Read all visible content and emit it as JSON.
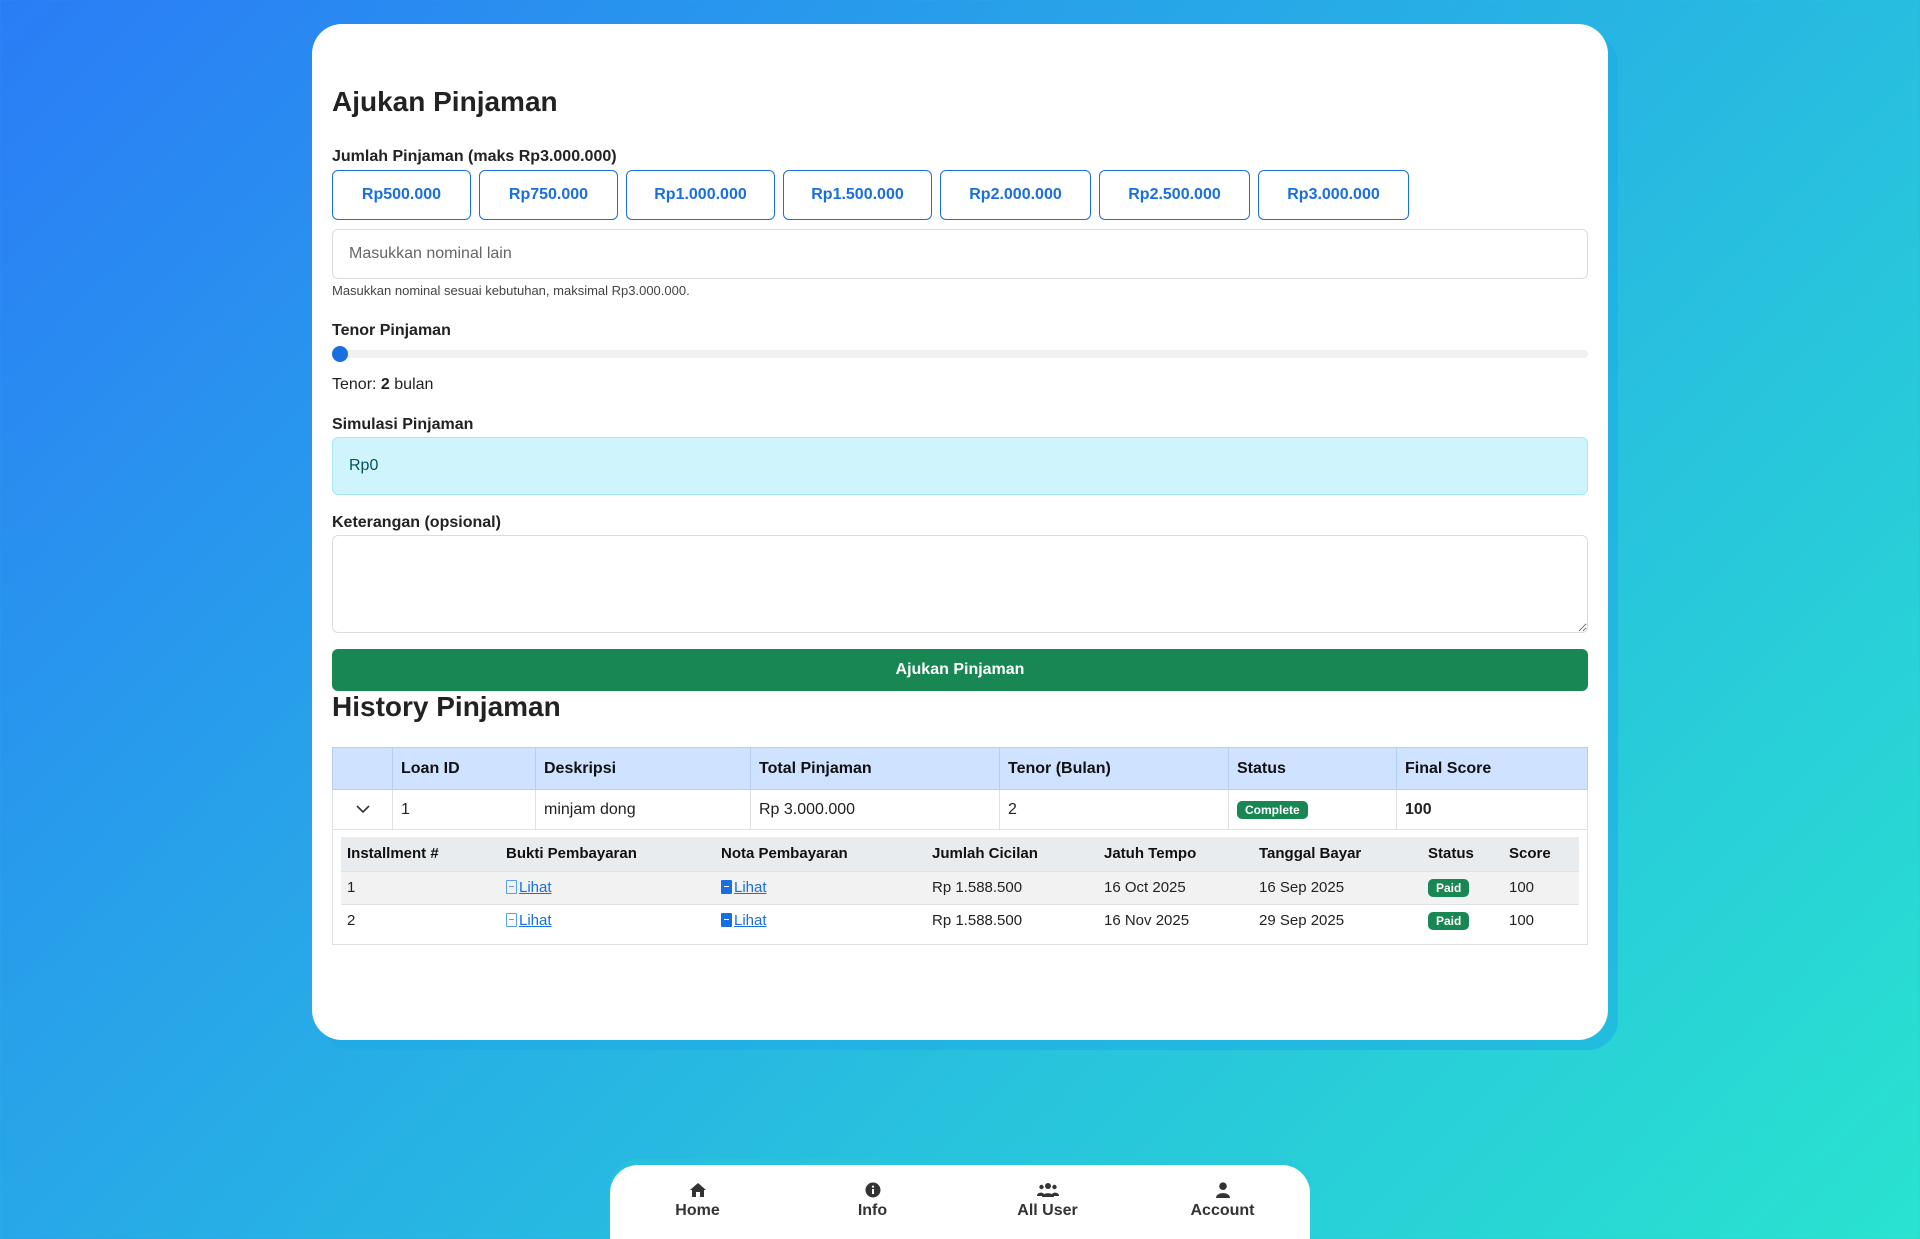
{
  "form": {
    "title": "Ajukan Pinjaman",
    "amount_label": "Jumlah Pinjaman (maks Rp3.000.000)",
    "amount_options": [
      "Rp500.000",
      "Rp750.000",
      "Rp1.000.000",
      "Rp1.500.000",
      "Rp2.000.000",
      "Rp2.500.000",
      "Rp3.000.000"
    ],
    "custom_placeholder": "Masukkan nominal lain",
    "custom_help": "Masukkan nominal sesuai kebutuhan, maksimal Rp3.000.000.",
    "tenor_label": "Tenor Pinjaman",
    "tenor_prefix": "Tenor:",
    "tenor_value": "2",
    "tenor_unit": "bulan",
    "tenor_slider_fraction": 0,
    "simulation_label": "Simulasi Pinjaman",
    "simulation_value": "Rp0",
    "notes_label": "Keterangan (opsional)",
    "submit_label": "Ajukan Pinjaman"
  },
  "history": {
    "title": "History Pinjaman",
    "columns": [
      "",
      "Loan ID",
      "Deskripsi",
      "Total Pinjaman",
      "Tenor (Bulan)",
      "Status",
      "Final Score"
    ],
    "loan": {
      "id": "1",
      "description": "minjam dong",
      "total": "Rp 3.000.000",
      "tenor": "2",
      "status": "Complete",
      "final_score": "100"
    },
    "installment_columns": [
      "Installment #",
      "Bukti Pembayaran",
      "Nota Pembayaran",
      "Jumlah Cicilan",
      "Jatuh Tempo",
      "Tanggal Bayar",
      "Status",
      "Score"
    ],
    "installments": [
      {
        "no": "1",
        "bukti": "Lihat",
        "nota": "Lihat",
        "amount": "Rp 1.588.500",
        "due": "16 Oct 2025",
        "paid_date": "16 Sep 2025",
        "status": "Paid",
        "score": "100"
      },
      {
        "no": "2",
        "bukti": "Lihat",
        "nota": "Lihat",
        "amount": "Rp 1.588.500",
        "due": "16 Nov 2025",
        "paid_date": "29 Sep 2025",
        "status": "Paid",
        "score": "100"
      }
    ]
  },
  "nav": {
    "items": [
      {
        "label": "Home",
        "icon": "home-icon"
      },
      {
        "label": "Info",
        "icon": "info-icon"
      },
      {
        "label": "All User",
        "icon": "users-icon"
      },
      {
        "label": "Account",
        "icon": "user-icon"
      }
    ]
  },
  "colors": {
    "primary": "#1a6fe0",
    "success": "#198754",
    "info_bg": "#cff4fc",
    "table_head": "#cfe2ff"
  }
}
